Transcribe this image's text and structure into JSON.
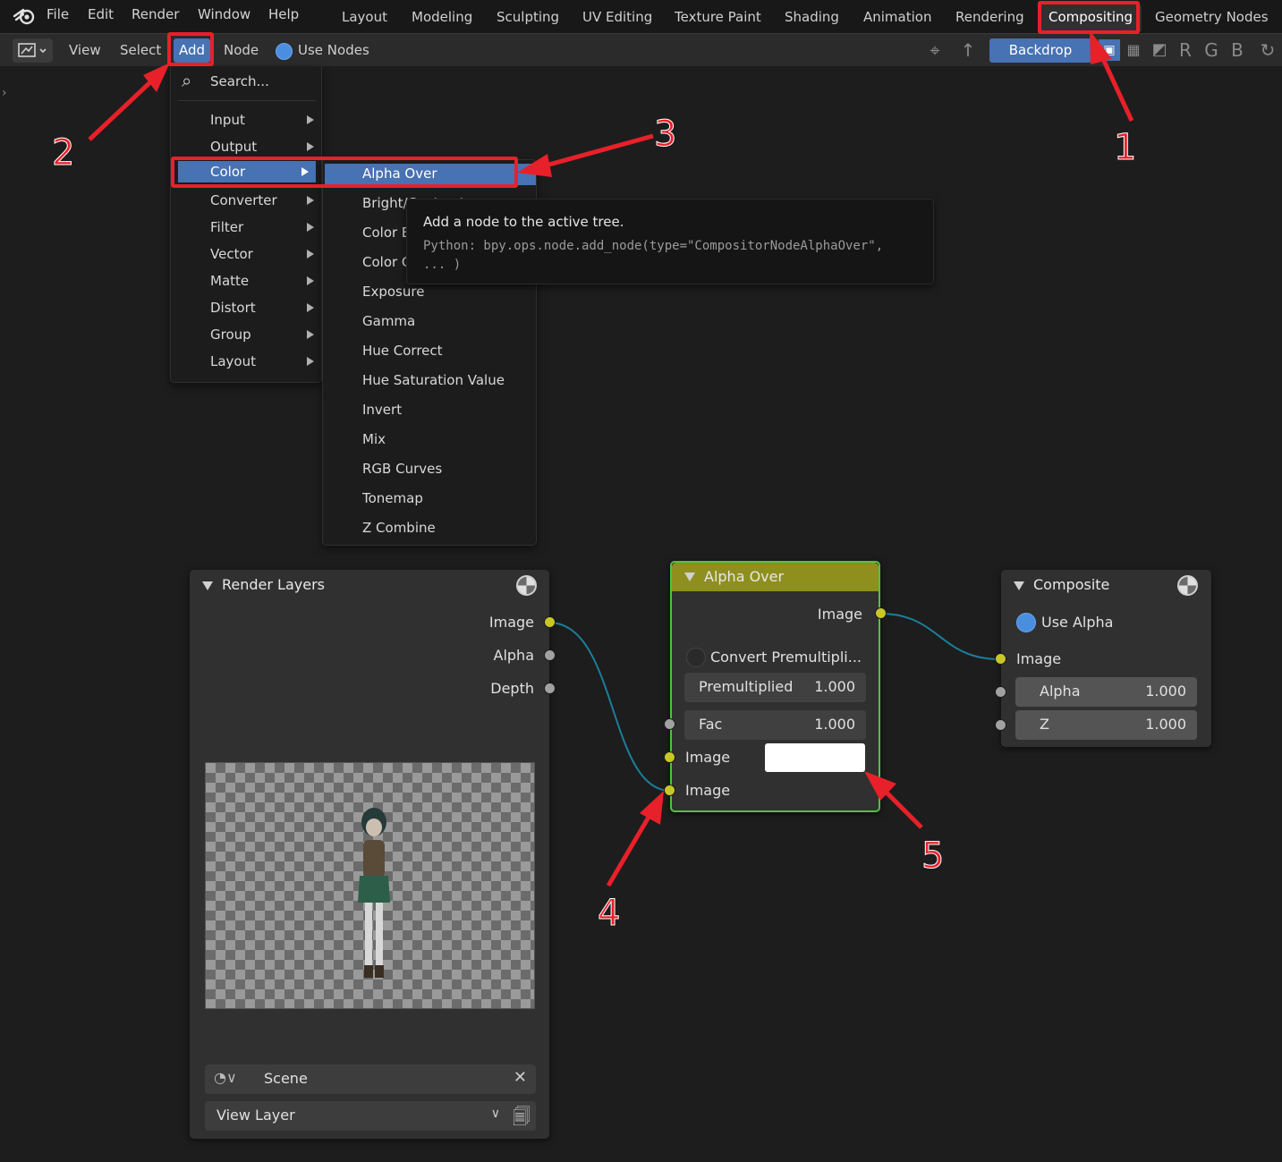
{
  "topbar": {
    "menus": [
      "File",
      "Edit",
      "Render",
      "Window",
      "Help"
    ],
    "workspaces": [
      "Layout",
      "Modeling",
      "Sculpting",
      "UV Editing",
      "Texture Paint",
      "Shading",
      "Animation",
      "Rendering",
      "Compositing",
      "Geometry Nodes"
    ],
    "active_workspace": "Compositing"
  },
  "header": {
    "view": "View",
    "select": "Select",
    "add": "Add",
    "node": "Node",
    "use_nodes": "Use Nodes",
    "backdrop": "Backdrop",
    "channels": [
      "R",
      "G",
      "B"
    ]
  },
  "add_menu": {
    "search": "Search...",
    "items": [
      "Input",
      "Output",
      "Color",
      "Converter",
      "Filter",
      "Vector",
      "Matte",
      "Distort",
      "Group",
      "Layout"
    ],
    "active": "Color"
  },
  "color_menu": {
    "items": [
      "Alpha Over",
      "Bright/Contrast",
      "Color Balance",
      "Color Correction",
      "Exposure",
      "Gamma",
      "Hue Correct",
      "Hue Saturation Value",
      "Invert",
      "Mix",
      "RGB Curves",
      "Tonemap",
      "Z Combine"
    ],
    "active": "Alpha Over"
  },
  "tooltip": {
    "title": "Add a node to the active tree.",
    "python": "Python: bpy.ops.node.add_node(type=\"CompositorNodeAlphaOver\",\n... )"
  },
  "nodes": {
    "render_layers": {
      "title": "Render Layers",
      "outputs": [
        "Image",
        "Alpha",
        "Depth"
      ],
      "scene": "Scene",
      "view_layer": "View Layer"
    },
    "alpha_over": {
      "title": "Alpha Over",
      "output": "Image",
      "convert_premul": "Convert Premultipli...",
      "premultiplied_label": "Premultiplied",
      "premultiplied_value": "1.000",
      "fac_label": "Fac",
      "fac_value": "1.000",
      "input1": "Image",
      "input2": "Image",
      "input1_color": "#ffffff"
    },
    "composite": {
      "title": "Composite",
      "use_alpha": "Use Alpha",
      "input_image": "Image",
      "alpha_label": "Alpha",
      "alpha_value": "1.000",
      "z_label": "Z",
      "z_value": "1.000"
    }
  },
  "annotations": [
    "1",
    "2",
    "3",
    "4",
    "5"
  ],
  "colors": {
    "accent": "#4772b3",
    "annotation": "#e8202a",
    "socket_image": "#c7c729",
    "socket_value": "#a1a1a1",
    "alpha_over_header": "#8f8f1e",
    "selected_outline": "#4fc33f"
  }
}
